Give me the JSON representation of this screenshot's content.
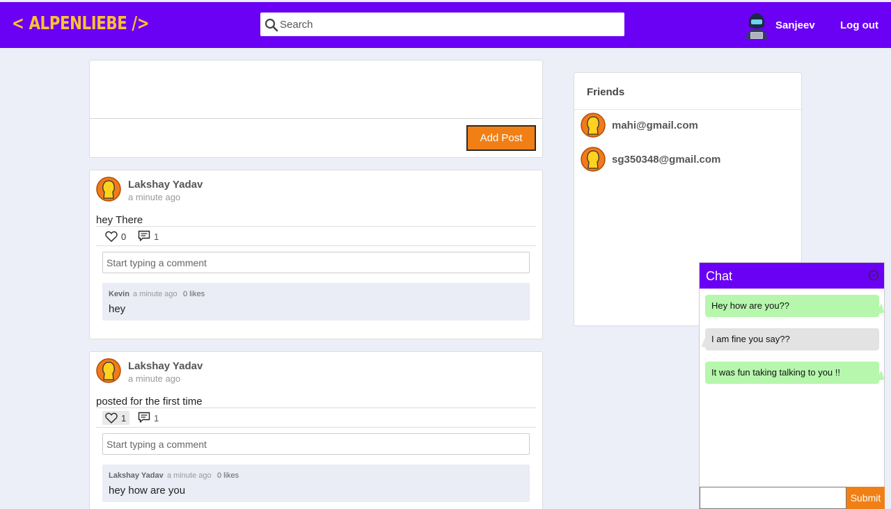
{
  "header": {
    "logo": "< ALPENLIEBE />",
    "search_placeholder": "Search",
    "user_name": "Sanjeev",
    "logout_label": "Log out"
  },
  "composer": {
    "add_post_label": "Add Post"
  },
  "posts": [
    {
      "author": "Lakshay Yadav",
      "time": "a minute ago",
      "content": "hey There",
      "likes": "0",
      "comments_count": "1",
      "liked": false,
      "comment_placeholder": "Start typing a comment",
      "comment": {
        "author": "Kevin",
        "time": "a minute ago",
        "likes": "0 likes",
        "text": "hey"
      }
    },
    {
      "author": "Lakshay Yadav",
      "time": "a minute ago",
      "content": "posted for the first time",
      "likes": "1",
      "comments_count": "1",
      "liked": true,
      "comment_placeholder": "Start typing a comment",
      "comment": {
        "author": "Lakshay Yadav",
        "time": "a minute ago",
        "likes": "0 likes",
        "text": "hey how are you"
      }
    }
  ],
  "friends": {
    "title": "Friends",
    "items": [
      {
        "email": "mahi@gmail.com"
      },
      {
        "email": "sg350348@gmail.com"
      }
    ]
  },
  "chat": {
    "title": "Chat",
    "messages": [
      {
        "text": "Hey how are you??",
        "type": "sent"
      },
      {
        "text": "I am fine you say??",
        "type": "received"
      },
      {
        "text": "It was fun taking talking to you !!",
        "type": "sent"
      }
    ],
    "input_value": "",
    "submit_label": "Submit"
  },
  "colors": {
    "primary": "#6a00f4",
    "logo": "#fdc030",
    "accent": "#f08016",
    "sent_bubble": "#b6f7ad",
    "received_bubble": "#e3e3e3",
    "page_bg": "#eceef8"
  },
  "icons": {
    "search": "search-icon",
    "like": "heart-icon",
    "comment": "comment-icon",
    "avatar": "avatar-icon",
    "chat_minimize": "minimize-icon"
  }
}
